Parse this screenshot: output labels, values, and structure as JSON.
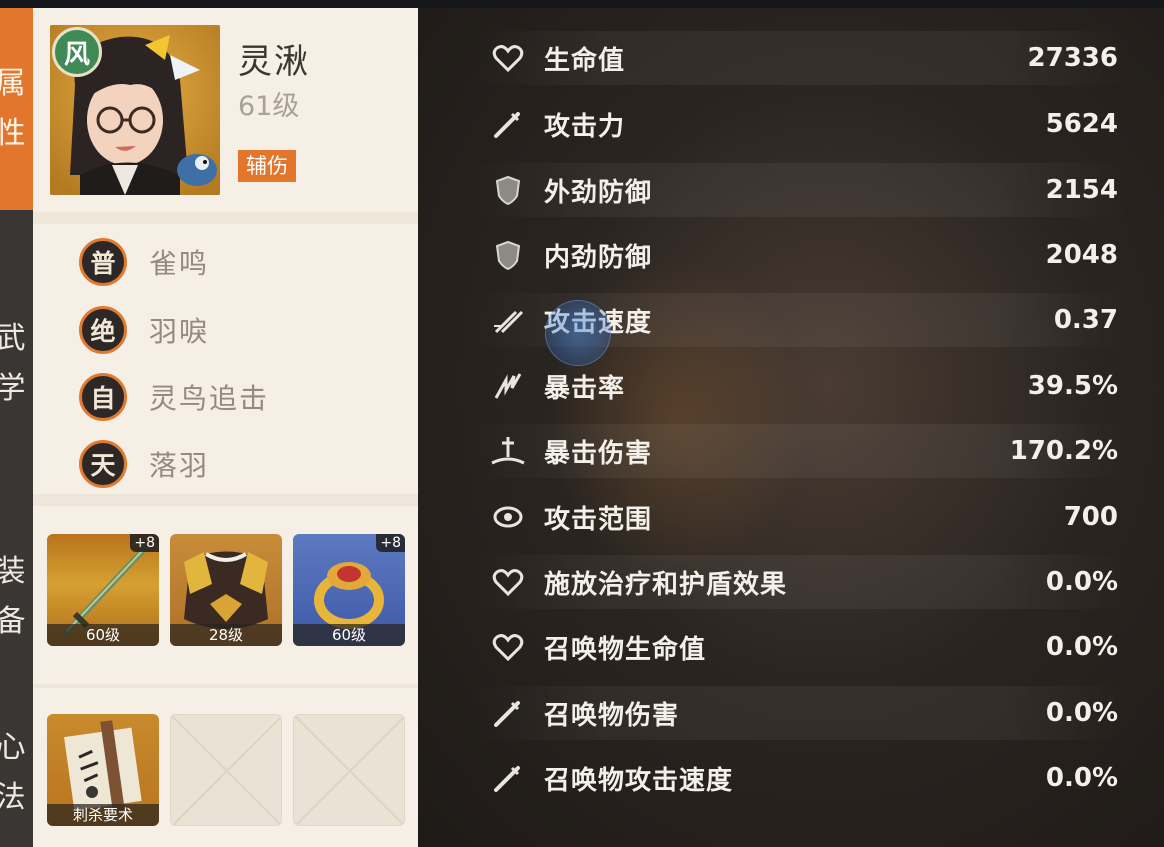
{
  "tabs": [
    {
      "label": "属性",
      "c1": "属",
      "c2": "性",
      "active": true
    },
    {
      "label": "武学",
      "c1": "武",
      "c2": "学",
      "active": false
    },
    {
      "label": "装备",
      "c1": "装",
      "c2": "备",
      "active": false
    },
    {
      "label": "心法",
      "c1": "心",
      "c2": "法",
      "active": false
    }
  ],
  "hero": {
    "element": "风",
    "name": "灵湫",
    "level": "61级",
    "role": "辅伤"
  },
  "skills": [
    {
      "badge": "普",
      "name": "雀鸣"
    },
    {
      "badge": "绝",
      "name": "羽唳"
    },
    {
      "badge": "自",
      "name": "灵鸟追击"
    },
    {
      "badge": "天",
      "name": "落羽"
    }
  ],
  "equipment": [
    {
      "icon": "sword-icon",
      "level": "60级",
      "plus": "+8"
    },
    {
      "icon": "armor-icon",
      "level": "28级",
      "plus": ""
    },
    {
      "icon": "ring-icon",
      "level": "60级",
      "plus": "+8"
    }
  ],
  "xinfa": [
    {
      "icon": "scroll-icon",
      "name": "刺杀要术"
    },
    {
      "icon": "empty-slot-icon",
      "name": ""
    },
    {
      "icon": "empty-slot-icon",
      "name": ""
    }
  ],
  "stats": [
    {
      "icon": "heart-icon",
      "label": "生命值",
      "value": "27336"
    },
    {
      "icon": "dagger-icon",
      "label": "攻击力",
      "value": "5624"
    },
    {
      "icon": "shield-icon",
      "label": "外劲防御",
      "value": "2154"
    },
    {
      "icon": "shield-icon",
      "label": "内劲防御",
      "value": "2048"
    },
    {
      "icon": "crossed-daggers-icon",
      "label": "攻击速度",
      "value": "0.37"
    },
    {
      "icon": "crit-icon",
      "label": "暴击率",
      "value": "39.5%"
    },
    {
      "icon": "crit-damage-icon",
      "label": "暴击伤害",
      "value": "170.2%"
    },
    {
      "icon": "range-icon",
      "label": "攻击范围",
      "value": "700"
    },
    {
      "icon": "heart-icon",
      "label": "施放治疗和护盾效果",
      "value": "0.0%"
    },
    {
      "icon": "heart-icon",
      "label": "召唤物生命值",
      "value": "0.0%"
    },
    {
      "icon": "dagger-icon",
      "label": "召唤物伤害",
      "value": "0.0%"
    },
    {
      "icon": "dagger-icon",
      "label": "召唤物攻击速度",
      "value": "0.0%"
    }
  ]
}
